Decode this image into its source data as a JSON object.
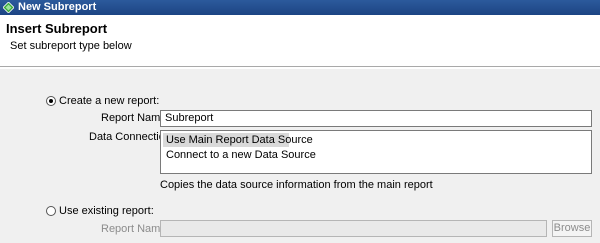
{
  "window": {
    "title": "New Subreport",
    "icon": "crystal-diamond-icon"
  },
  "header": {
    "title": "Insert Subreport",
    "subtitle": "Set subreport type below"
  },
  "create_new": {
    "radio_label": "Create a new report:",
    "checked": true,
    "report_name_label": "Report Name:",
    "report_name_value": "Subreport",
    "data_connection_label": "Data Connection:",
    "data_connection_options": [
      "Use Main Report Data Source",
      "Connect to a new Data Source"
    ],
    "selected_option": "Use Main Report Data Source",
    "description": "Copies the data source information from the main report"
  },
  "use_existing": {
    "radio_label": "Use existing report:",
    "checked": false,
    "report_name_label": "Report Name:",
    "report_name_value": "",
    "browse_label": "Browse"
  }
}
